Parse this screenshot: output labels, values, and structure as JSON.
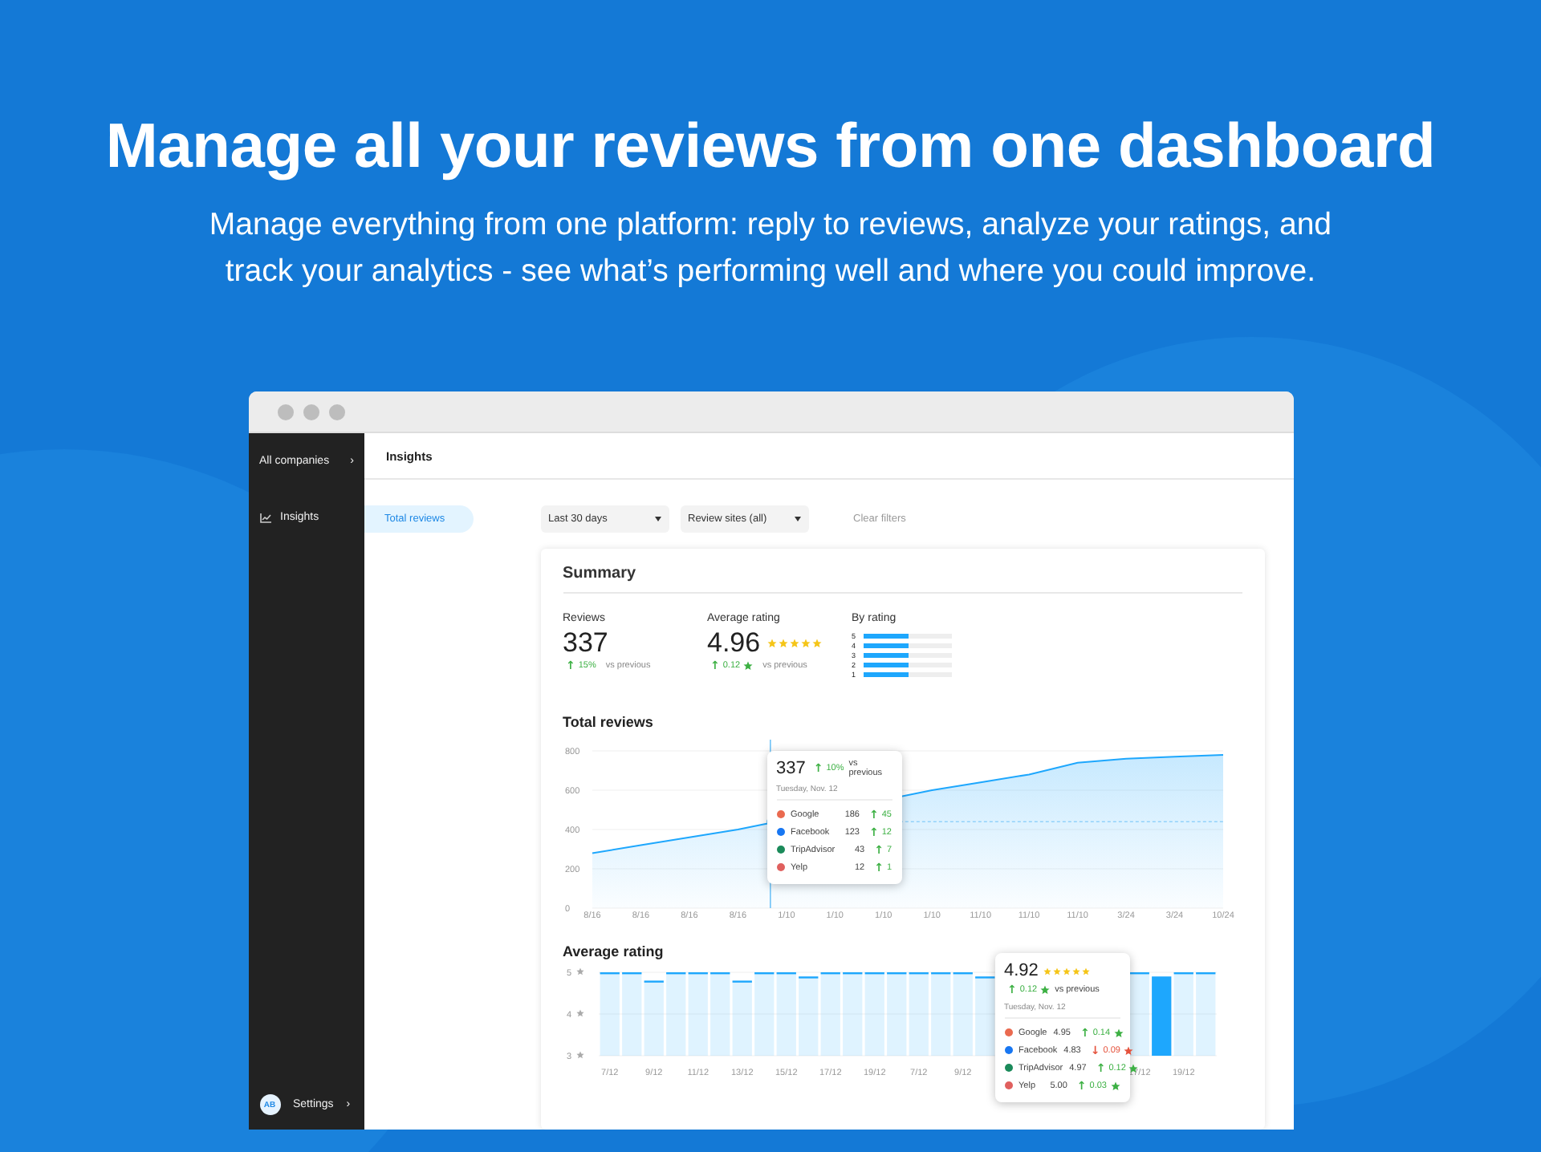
{
  "hero": {
    "title": "Manage all your reviews from one dashboard",
    "subtitle": "Manage everything from one platform: reply to reviews, analyze your ratings, and track your analytics - see what’s performing well and where you could improve."
  },
  "window": {
    "sidebar": {
      "company": "All companies",
      "company_chevron": "›",
      "items": [
        {
          "label": "Insights"
        }
      ],
      "user": {
        "initials": "AB",
        "label": "Settings",
        "chevron": "›"
      }
    },
    "page_title": "Insights",
    "tabs": [
      {
        "label": "Total reviews",
        "selected": true
      }
    ],
    "filters": [
      {
        "label": "Last 30 days"
      },
      {
        "label": "Review sites (all)"
      }
    ],
    "clear_filters": "Clear filters",
    "summary": {
      "title": "Summary",
      "reviews": {
        "label": "Reviews",
        "value": "337",
        "change": {
          "arrow": "↑",
          "text": "15%",
          "color": "#3cb043"
        },
        "vs": "vs previous"
      },
      "average": {
        "label": "Average rating",
        "value": "4.96",
        "stars": 5,
        "change": {
          "arrow": "↑",
          "text": "0.12",
          "color": "#3cb043"
        },
        "vs": "vs previous"
      },
      "by_rating": {
        "label": "By rating",
        "rows": [
          {
            "label": "5",
            "level": 0.52
          },
          {
            "label": "4",
            "level": 0.52
          },
          {
            "label": "3",
            "level": 0.52
          },
          {
            "label": "2",
            "level": 0.52
          },
          {
            "label": "1",
            "level": 0.52
          }
        ]
      }
    },
    "total_reviews": {
      "title": "Total reviews",
      "chart_data": {
        "type": "area",
        "categories": [
          "8/16",
          "8/16",
          "8/16",
          "8/16",
          "1/10",
          "1/10",
          "1/10",
          "1/10",
          "11/10",
          "11/10",
          "11/10",
          "3/24",
          "3/24",
          "10/24"
        ],
        "yticks": [
          0,
          200,
          400,
          600,
          800
        ],
        "ylim": [
          0,
          800
        ],
        "grid": true,
        "series": [
          {
            "color": "#1ea7fd",
            "values": [
              280,
              320,
              360,
              400,
              null,
              null,
              null,
              600,
              640,
              680,
              740,
              760,
              770,
              780
            ]
          }
        ]
      },
      "tooltip": {
        "value": "337",
        "change": {
          "arrow": "↑",
          "text": "10%",
          "color": "#3cb043"
        },
        "vs": "vs previous",
        "date": "Tuesday, Nov. 12",
        "rows": [
          {
            "name": "Google",
            "color": "#ea6a4f",
            "value": "186",
            "change": {
              "arrow": "↑",
              "text": "45",
              "color": "#3cb043"
            }
          },
          {
            "name": "Facebook",
            "color": "#1877f2",
            "value": "123",
            "change": {
              "arrow": "↑",
              "text": "12",
              "color": "#3cb043"
            }
          },
          {
            "name": "TripAdvisor",
            "color": "#1b8a5a",
            "value": "43",
            "change": {
              "arrow": "↑",
              "text": "7",
              "color": "#3cb043"
            }
          },
          {
            "name": "Yelp",
            "color": "#e0605e",
            "value": "12",
            "change": {
              "arrow": "↑",
              "text": "1",
              "color": "#3cb043"
            }
          }
        ]
      }
    },
    "average_rating": {
      "title": "Average rating",
      "chart_data": {
        "type": "bar",
        "categories": [
          "7/12",
          null,
          "9/12",
          null,
          "11/12",
          null,
          "13/12",
          null,
          "15/12",
          null,
          "17/12",
          null,
          "19/12",
          null,
          "7/12",
          null,
          "9/12",
          null,
          null,
          null,
          null,
          null,
          null,
          null,
          "17/12",
          null,
          "19/12",
          null
        ],
        "yticks": [
          {
            "value": 3,
            "label": "3"
          },
          {
            "value": 4,
            "label": "4"
          },
          {
            "value": 5,
            "label": "5"
          }
        ],
        "ylim": [
          3,
          5
        ],
        "grid": true,
        "series": [
          {
            "color": "#1ea7fd",
            "values": [
              5,
              5,
              4.8,
              5,
              5,
              5,
              4.8,
              5,
              5,
              4.9,
              5,
              5,
              5,
              5,
              5,
              5,
              5,
              4.9,
              null,
              null,
              null,
              null,
              null,
              null,
              5,
              4.9,
              5,
              5
            ]
          }
        ]
      },
      "tooltip": {
        "value": "4.92",
        "stars": 5,
        "change": {
          "arrow": "↑",
          "text": "0.12",
          "color": "#3cb043"
        },
        "vs": "vs previous",
        "date": "Tuesday, Nov. 12",
        "rows": [
          {
            "name": "Google",
            "color": "#ea6a4f",
            "value": "4.95",
            "change": {
              "arrow": "↑",
              "text": "0.14",
              "color": "#3cb043"
            }
          },
          {
            "name": "Facebook",
            "color": "#1877f2",
            "value": "4.83",
            "change": {
              "arrow": "↓",
              "text": "0.09",
              "color": "#e5533d"
            }
          },
          {
            "name": "TripAdvisor",
            "color": "#1b8a5a",
            "value": "4.97",
            "change": {
              "arrow": "↑",
              "text": "0.12",
              "color": "#3cb043"
            }
          },
          {
            "name": "Yelp",
            "color": "#e0605e",
            "value": "5.00",
            "change": {
              "arrow": "↑",
              "text": "0.03",
              "color": "#3cb043"
            }
          }
        ]
      }
    }
  }
}
